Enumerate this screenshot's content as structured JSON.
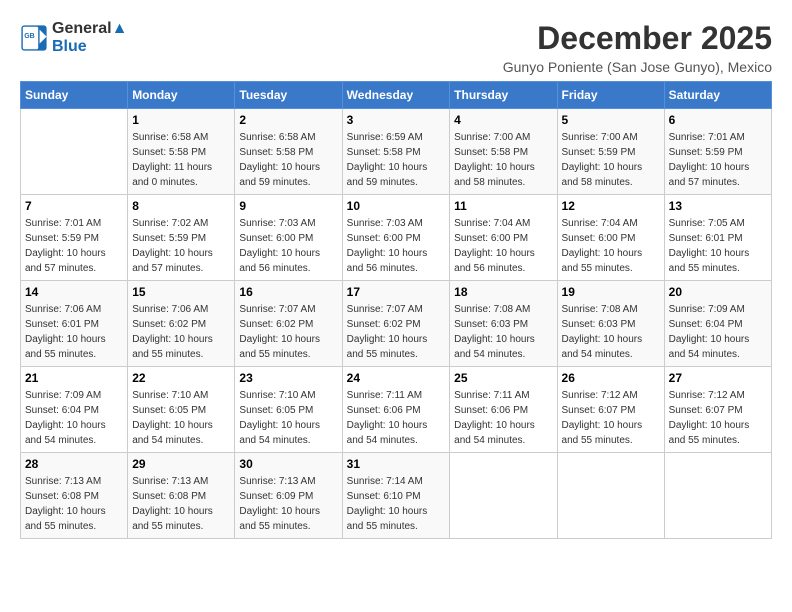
{
  "logo": {
    "line1": "General",
    "line2": "Blue"
  },
  "title": "December 2025",
  "subtitle": "Gunyo Poniente (San Jose Gunyo), Mexico",
  "days_of_week": [
    "Sunday",
    "Monday",
    "Tuesday",
    "Wednesday",
    "Thursday",
    "Friday",
    "Saturday"
  ],
  "weeks": [
    [
      {
        "day": "",
        "sunrise": "",
        "sunset": "",
        "daylight": ""
      },
      {
        "day": "1",
        "sunrise": "Sunrise: 6:58 AM",
        "sunset": "Sunset: 5:58 PM",
        "daylight": "Daylight: 11 hours and 0 minutes."
      },
      {
        "day": "2",
        "sunrise": "Sunrise: 6:58 AM",
        "sunset": "Sunset: 5:58 PM",
        "daylight": "Daylight: 10 hours and 59 minutes."
      },
      {
        "day": "3",
        "sunrise": "Sunrise: 6:59 AM",
        "sunset": "Sunset: 5:58 PM",
        "daylight": "Daylight: 10 hours and 59 minutes."
      },
      {
        "day": "4",
        "sunrise": "Sunrise: 7:00 AM",
        "sunset": "Sunset: 5:58 PM",
        "daylight": "Daylight: 10 hours and 58 minutes."
      },
      {
        "day": "5",
        "sunrise": "Sunrise: 7:00 AM",
        "sunset": "Sunset: 5:59 PM",
        "daylight": "Daylight: 10 hours and 58 minutes."
      },
      {
        "day": "6",
        "sunrise": "Sunrise: 7:01 AM",
        "sunset": "Sunset: 5:59 PM",
        "daylight": "Daylight: 10 hours and 57 minutes."
      }
    ],
    [
      {
        "day": "7",
        "sunrise": "Sunrise: 7:01 AM",
        "sunset": "Sunset: 5:59 PM",
        "daylight": "Daylight: 10 hours and 57 minutes."
      },
      {
        "day": "8",
        "sunrise": "Sunrise: 7:02 AM",
        "sunset": "Sunset: 5:59 PM",
        "daylight": "Daylight: 10 hours and 57 minutes."
      },
      {
        "day": "9",
        "sunrise": "Sunrise: 7:03 AM",
        "sunset": "Sunset: 6:00 PM",
        "daylight": "Daylight: 10 hours and 56 minutes."
      },
      {
        "day": "10",
        "sunrise": "Sunrise: 7:03 AM",
        "sunset": "Sunset: 6:00 PM",
        "daylight": "Daylight: 10 hours and 56 minutes."
      },
      {
        "day": "11",
        "sunrise": "Sunrise: 7:04 AM",
        "sunset": "Sunset: 6:00 PM",
        "daylight": "Daylight: 10 hours and 56 minutes."
      },
      {
        "day": "12",
        "sunrise": "Sunrise: 7:04 AM",
        "sunset": "Sunset: 6:00 PM",
        "daylight": "Daylight: 10 hours and 55 minutes."
      },
      {
        "day": "13",
        "sunrise": "Sunrise: 7:05 AM",
        "sunset": "Sunset: 6:01 PM",
        "daylight": "Daylight: 10 hours and 55 minutes."
      }
    ],
    [
      {
        "day": "14",
        "sunrise": "Sunrise: 7:06 AM",
        "sunset": "Sunset: 6:01 PM",
        "daylight": "Daylight: 10 hours and 55 minutes."
      },
      {
        "day": "15",
        "sunrise": "Sunrise: 7:06 AM",
        "sunset": "Sunset: 6:02 PM",
        "daylight": "Daylight: 10 hours and 55 minutes."
      },
      {
        "day": "16",
        "sunrise": "Sunrise: 7:07 AM",
        "sunset": "Sunset: 6:02 PM",
        "daylight": "Daylight: 10 hours and 55 minutes."
      },
      {
        "day": "17",
        "sunrise": "Sunrise: 7:07 AM",
        "sunset": "Sunset: 6:02 PM",
        "daylight": "Daylight: 10 hours and 55 minutes."
      },
      {
        "day": "18",
        "sunrise": "Sunrise: 7:08 AM",
        "sunset": "Sunset: 6:03 PM",
        "daylight": "Daylight: 10 hours and 54 minutes."
      },
      {
        "day": "19",
        "sunrise": "Sunrise: 7:08 AM",
        "sunset": "Sunset: 6:03 PM",
        "daylight": "Daylight: 10 hours and 54 minutes."
      },
      {
        "day": "20",
        "sunrise": "Sunrise: 7:09 AM",
        "sunset": "Sunset: 6:04 PM",
        "daylight": "Daylight: 10 hours and 54 minutes."
      }
    ],
    [
      {
        "day": "21",
        "sunrise": "Sunrise: 7:09 AM",
        "sunset": "Sunset: 6:04 PM",
        "daylight": "Daylight: 10 hours and 54 minutes."
      },
      {
        "day": "22",
        "sunrise": "Sunrise: 7:10 AM",
        "sunset": "Sunset: 6:05 PM",
        "daylight": "Daylight: 10 hours and 54 minutes."
      },
      {
        "day": "23",
        "sunrise": "Sunrise: 7:10 AM",
        "sunset": "Sunset: 6:05 PM",
        "daylight": "Daylight: 10 hours and 54 minutes."
      },
      {
        "day": "24",
        "sunrise": "Sunrise: 7:11 AM",
        "sunset": "Sunset: 6:06 PM",
        "daylight": "Daylight: 10 hours and 54 minutes."
      },
      {
        "day": "25",
        "sunrise": "Sunrise: 7:11 AM",
        "sunset": "Sunset: 6:06 PM",
        "daylight": "Daylight: 10 hours and 54 minutes."
      },
      {
        "day": "26",
        "sunrise": "Sunrise: 7:12 AM",
        "sunset": "Sunset: 6:07 PM",
        "daylight": "Daylight: 10 hours and 55 minutes."
      },
      {
        "day": "27",
        "sunrise": "Sunrise: 7:12 AM",
        "sunset": "Sunset: 6:07 PM",
        "daylight": "Daylight: 10 hours and 55 minutes."
      }
    ],
    [
      {
        "day": "28",
        "sunrise": "Sunrise: 7:13 AM",
        "sunset": "Sunset: 6:08 PM",
        "daylight": "Daylight: 10 hours and 55 minutes."
      },
      {
        "day": "29",
        "sunrise": "Sunrise: 7:13 AM",
        "sunset": "Sunset: 6:08 PM",
        "daylight": "Daylight: 10 hours and 55 minutes."
      },
      {
        "day": "30",
        "sunrise": "Sunrise: 7:13 AM",
        "sunset": "Sunset: 6:09 PM",
        "daylight": "Daylight: 10 hours and 55 minutes."
      },
      {
        "day": "31",
        "sunrise": "Sunrise: 7:14 AM",
        "sunset": "Sunset: 6:10 PM",
        "daylight": "Daylight: 10 hours and 55 minutes."
      },
      {
        "day": "",
        "sunrise": "",
        "sunset": "",
        "daylight": ""
      },
      {
        "day": "",
        "sunrise": "",
        "sunset": "",
        "daylight": ""
      },
      {
        "day": "",
        "sunrise": "",
        "sunset": "",
        "daylight": ""
      }
    ]
  ]
}
